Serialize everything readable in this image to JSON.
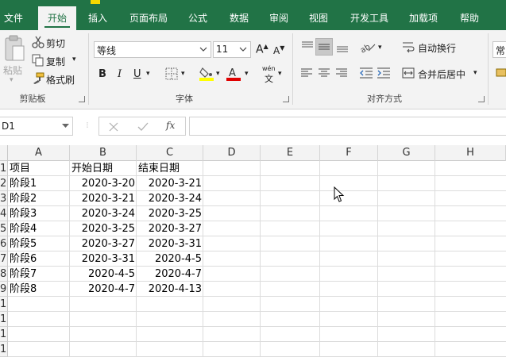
{
  "ribbon_tabs": [
    {
      "label": "文件",
      "active": false
    },
    {
      "label": "开始",
      "active": true
    },
    {
      "label": "插入",
      "active": false
    },
    {
      "label": "页面布局",
      "active": false
    },
    {
      "label": "公式",
      "active": false
    },
    {
      "label": "数据",
      "active": false
    },
    {
      "label": "审阅",
      "active": false
    },
    {
      "label": "视图",
      "active": false
    },
    {
      "label": "开发工具",
      "active": false
    },
    {
      "label": "加载项",
      "active": false
    },
    {
      "label": "帮助",
      "active": false
    }
  ],
  "clipboard": {
    "paste_label": "粘贴",
    "cut_label": "剪切",
    "copy_label": "复制",
    "format_painter_label": "格式刷",
    "group_label": "剪贴板"
  },
  "font": {
    "font_name": "等线",
    "font_size": "11",
    "bold": "B",
    "italic": "I",
    "underline": "U",
    "phonetic_top": "wén",
    "phonetic_bottom": "文",
    "grow": "A",
    "shrink": "A",
    "group_label": "字体"
  },
  "alignment": {
    "wrap_text_label": "自动换行",
    "merge_center_label": "合并后居中",
    "group_label": "对齐方式"
  },
  "number": {
    "format_partial": "常"
  },
  "formula_bar": {
    "name_box": "D1",
    "fx": "fx",
    "formula_value": ""
  },
  "columns": [
    "A",
    "B",
    "C",
    "D",
    "E",
    "F",
    "G",
    "H"
  ],
  "rows": [
    {
      "num": "1",
      "a": "项目",
      "b": "开始日期",
      "c": "结束日期"
    },
    {
      "num": "2",
      "a": "阶段1",
      "b": "2020-3-20",
      "c": "2020-3-21"
    },
    {
      "num": "3",
      "a": "阶段2",
      "b": "2020-3-21",
      "c": "2020-3-24"
    },
    {
      "num": "4",
      "a": "阶段3",
      "b": "2020-3-24",
      "c": "2020-3-25"
    },
    {
      "num": "5",
      "a": "阶段4",
      "b": "2020-3-25",
      "c": "2020-3-27"
    },
    {
      "num": "6",
      "a": "阶段5",
      "b": "2020-3-27",
      "c": "2020-3-31"
    },
    {
      "num": "7",
      "a": "阶段6",
      "b": "2020-3-31",
      "c": "2020-4-5"
    },
    {
      "num": "8",
      "a": "阶段7",
      "b": "2020-4-5",
      "c": "2020-4-7"
    },
    {
      "num": "9",
      "a": "阶段8",
      "b": "2020-4-7",
      "c": "2020-4-13"
    },
    {
      "num": "10",
      "a": "",
      "b": "",
      "c": ""
    },
    {
      "num": "11",
      "a": "",
      "b": "",
      "c": ""
    },
    {
      "num": "12",
      "a": "",
      "b": "",
      "c": ""
    },
    {
      "num": "13",
      "a": "",
      "b": "",
      "c": ""
    }
  ],
  "colors": {
    "accent": "#217346",
    "highlight_yellow": "#ffff00",
    "font_red": "#e00000"
  }
}
